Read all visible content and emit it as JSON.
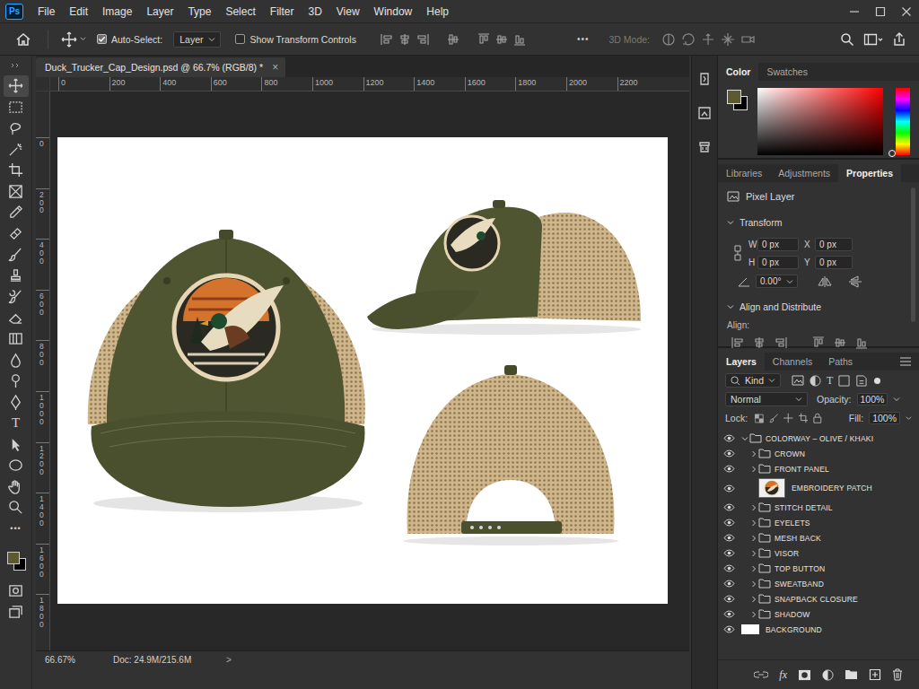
{
  "app": {
    "logo": "Ps",
    "menu": [
      "File",
      "Edit",
      "Image",
      "Layer",
      "Type",
      "Select",
      "Filter",
      "3D",
      "View",
      "Window",
      "Help"
    ]
  },
  "options_bar": {
    "auto_select": {
      "label": "Auto-Select:",
      "checked": true
    },
    "target": "Layer",
    "transform_controls": {
      "label": "Show Transform Controls",
      "checked": false
    },
    "more": "•••",
    "mode_3d": {
      "label": "3D Mode:",
      "disabled": true
    }
  },
  "toolbar": {
    "type_tool": "T",
    "more": "•••",
    "foreground": "#5b5a30",
    "background": "#000000"
  },
  "document": {
    "tab": "Duck_Trucker_Cap_Design.psd @ 66.7% (RGB/8) *",
    "close": "×",
    "ruler_h": [
      "0",
      "200",
      "400",
      "600",
      "800",
      "1000",
      "1200",
      "1400",
      "1600",
      "1800",
      "2000",
      "2200"
    ],
    "ruler_v": [
      "0",
      "200",
      "400",
      "600",
      "800",
      "1000",
      "1200",
      "1400",
      "1600",
      "1800"
    ],
    "zoom": "66.67%",
    "doc_info": "Doc: 24.9M/215.6M",
    "status_arrow": ">"
  },
  "color_panel": {
    "tabs": [
      {
        "label": "Color",
        "selected": true
      },
      {
        "label": "Swatches",
        "selected": false
      }
    ],
    "foreground": "#5b5a30",
    "background": "#000000",
    "hue": "#ff0000"
  },
  "properties_panel": {
    "tabs": [
      {
        "label": "Libraries",
        "selected": false
      },
      {
        "label": "Adjustments",
        "selected": false
      },
      {
        "label": "Properties",
        "selected": true
      }
    ],
    "layer_kind": "Pixel Layer",
    "transform": {
      "title": "Transform",
      "fields": [
        {
          "label": "W",
          "value": "0 px"
        },
        {
          "label": "X",
          "value": "0 px"
        },
        {
          "label": "H",
          "value": "0 px"
        },
        {
          "label": "Y",
          "value": "0 px"
        }
      ],
      "angle": "0.00°"
    },
    "align": {
      "title": "Align and Distribute",
      "label": "Align:"
    }
  },
  "layers_panel": {
    "tabs": [
      {
        "label": "Layers",
        "selected": true
      },
      {
        "label": "Channels",
        "selected": false
      },
      {
        "label": "Paths",
        "selected": false
      }
    ],
    "filter": "Kind",
    "filter_text": "T",
    "blend": "Normal",
    "opacity_label": "Opacity:",
    "opacity": "100%",
    "lock_label": "Lock:",
    "fill_label": "Fill:",
    "fill": "100%",
    "fx": "fx",
    "layers": [
      {
        "name": "COLORWAY – OLIVE / KHAKI",
        "kind": "group",
        "expanded": true,
        "visible": true,
        "children": [
          {
            "name": "CROWN",
            "kind": "group",
            "expanded": false,
            "visible": true
          },
          {
            "name": "FRONT PANEL",
            "kind": "group",
            "expanded": false,
            "visible": true
          },
          {
            "name": "EMBROIDERY PATCH",
            "kind": "pixel",
            "visible": true
          },
          {
            "name": "STITCH DETAIL",
            "kind": "group",
            "expanded": false,
            "visible": true
          },
          {
            "name": "EYELETS",
            "kind": "group",
            "expanded": false,
            "visible": true
          },
          {
            "name": "MESH BACK",
            "kind": "group",
            "expanded": false,
            "visible": true
          },
          {
            "name": "VISOR",
            "kind": "group",
            "expanded": false,
            "visible": true
          },
          {
            "name": "TOP BUTTON",
            "kind": "group",
            "expanded": false,
            "visible": true
          },
          {
            "name": "SWEATBAND",
            "kind": "group",
            "expanded": false,
            "visible": true
          },
          {
            "name": "SNAPBACK CLOSURE",
            "kind": "group",
            "expanded": false,
            "visible": true
          },
          {
            "name": "SHADOW",
            "kind": "group",
            "expanded": false,
            "visible": true
          }
        ]
      },
      {
        "name": "BACKGROUND",
        "kind": "background",
        "visible": true
      }
    ]
  }
}
